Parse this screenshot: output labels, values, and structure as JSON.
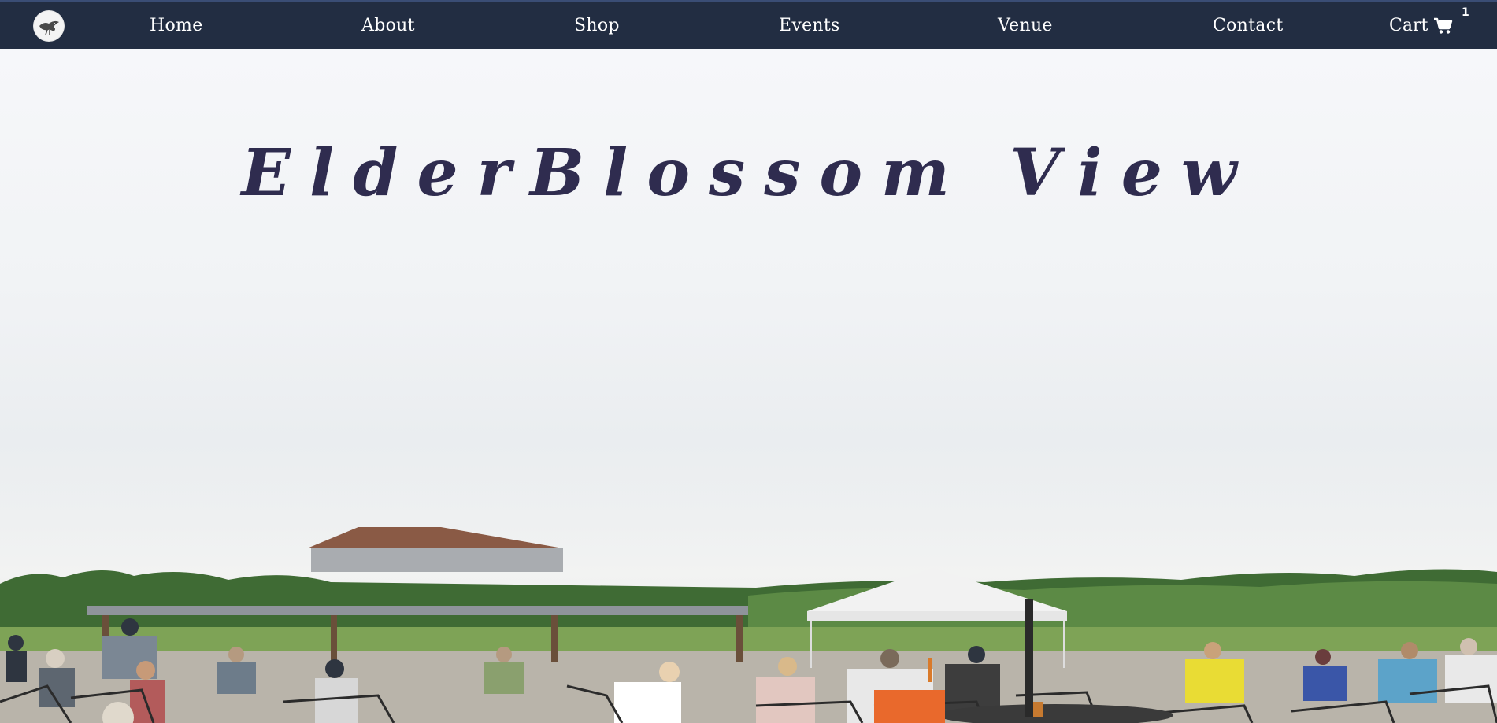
{
  "nav": {
    "logo_icon": "bird-logo-icon",
    "links": [
      {
        "label": "Home"
      },
      {
        "label": "About"
      },
      {
        "label": "Shop"
      },
      {
        "label": "Events"
      },
      {
        "label": "Venue"
      },
      {
        "label": "Contact"
      }
    ],
    "cart": {
      "label": "Cart",
      "icon": "shopping-cart-icon",
      "count": "1"
    }
  },
  "hero": {
    "title": "ElderBlossom View",
    "image_subject": "crowd-at-outdoor-concert-venue"
  },
  "colors": {
    "nav_background": "#222d42",
    "nav_text": "#ffffff",
    "title_color": "#2f2c4f"
  }
}
